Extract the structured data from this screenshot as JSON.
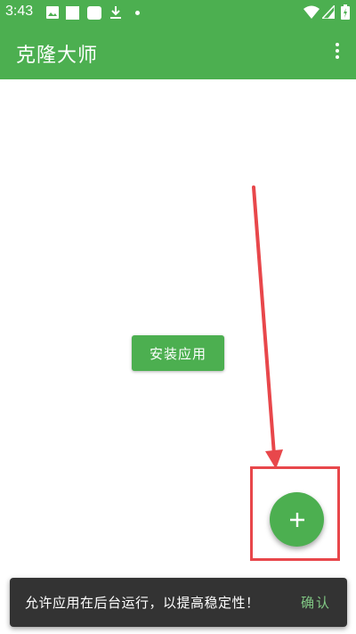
{
  "status_bar": {
    "time": "3:43",
    "left_icons": [
      "image-icon",
      "square-notification-icon",
      "youtube-icon",
      "download-icon",
      "dot-icon"
    ],
    "right_icons": [
      "wifi-icon",
      "signal-icon",
      "battery-charging-icon"
    ]
  },
  "app_bar": {
    "title": "克隆大师",
    "menu_icon": "overflow-menu-icon"
  },
  "main": {
    "install_button_label": "安装应用",
    "fab_icon": "plus-icon"
  },
  "annotation": {
    "color": "#e8474b"
  },
  "snackbar": {
    "message": "允许应用在后台运行，以提高稳定性！",
    "action_label": "确认"
  },
  "colors": {
    "primary": "#4caf50",
    "snackbar_bg": "#333333",
    "action": "#81c784"
  }
}
